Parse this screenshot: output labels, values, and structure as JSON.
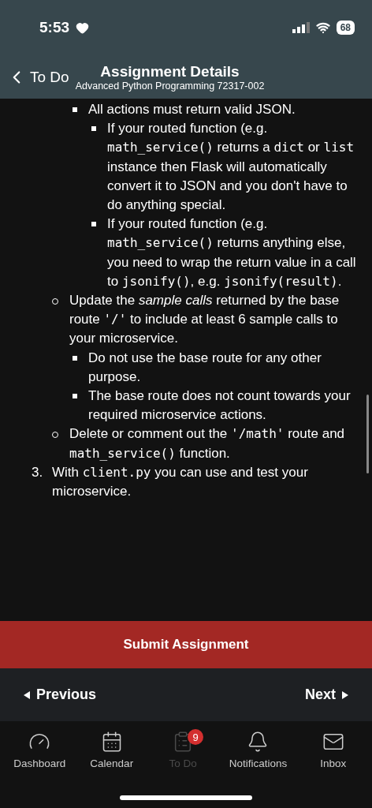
{
  "status_bar": {
    "time": "5:53",
    "battery": "68"
  },
  "header": {
    "back": "To Do",
    "title": "Assignment Details",
    "subtitle": "Advanced Python Programming 72317-002"
  },
  "content": [
    {
      "children": [
        {
          "children": [
            {
              "kind": "square",
              "segments": [
                {
                  "text": "All actions must return valid JSON."
                }
              ],
              "children": [
                {
                  "kind": "square",
                  "segments": [
                    {
                      "text": "If your routed function (e.g. "
                    },
                    {
                      "text": "math_service()",
                      "kind": "code"
                    },
                    {
                      "text": " returns a "
                    },
                    {
                      "text": "dict",
                      "kind": "code"
                    },
                    {
                      "text": " or "
                    },
                    {
                      "text": "list",
                      "kind": "code"
                    },
                    {
                      "text": " instance then Flask will automatically convert it to JSON and you don't have to do anything special."
                    }
                  ]
                },
                {
                  "kind": "square",
                  "segments": [
                    {
                      "text": "If your routed function (e.g. "
                    },
                    {
                      "text": "math_service()",
                      "kind": "code"
                    },
                    {
                      "text": " returns anything else, you need to wrap the return value in a call to "
                    },
                    {
                      "text": "jsonify()",
                      "kind": "code"
                    },
                    {
                      "text": ", e.g. "
                    },
                    {
                      "text": "jsonify(result)",
                      "kind": "code"
                    },
                    {
                      "text": "."
                    }
                  ]
                }
              ]
            }
          ]
        },
        {
          "kind": "circle",
          "segments": [
            {
              "text": "Update the "
            },
            {
              "text": "sample calls",
              "kind": "italic"
            },
            {
              "text": " returned by the base route "
            },
            {
              "text": "'/'",
              "kind": "code"
            },
            {
              "text": " to include at least 6 sample calls to your microservice."
            }
          ],
          "children": [
            {
              "kind": "square",
              "segments": [
                {
                  "text": "Do not use the base route for any other purpose."
                }
              ]
            },
            {
              "kind": "square",
              "segments": [
                {
                  "text": "The base route does not count towards your required microservice actions."
                }
              ]
            }
          ]
        },
        {
          "kind": "circle",
          "segments": [
            {
              "text": "Delete or comment out the "
            },
            {
              "text": "'/math'",
              "kind": "code"
            },
            {
              "text": " route and "
            },
            {
              "text": "math_service()",
              "kind": "code"
            },
            {
              "text": " function."
            }
          ]
        }
      ]
    },
    {
      "number": "3.",
      "segments": [
        {
          "text": "With "
        },
        {
          "text": "client.py",
          "kind": "code"
        },
        {
          "text": " you can use and test your microservice."
        }
      ]
    }
  ],
  "submit_button": "Submit Assignment",
  "pager": {
    "previous": "Previous",
    "next": "Next"
  },
  "tab_bar": [
    {
      "label": "Dashboard",
      "selected": false
    },
    {
      "label": "Calendar",
      "selected": false
    },
    {
      "label": "To Do",
      "selected": true,
      "badge": "9"
    },
    {
      "label": "Notifications",
      "selected": false
    },
    {
      "label": "Inbox",
      "selected": false
    }
  ]
}
